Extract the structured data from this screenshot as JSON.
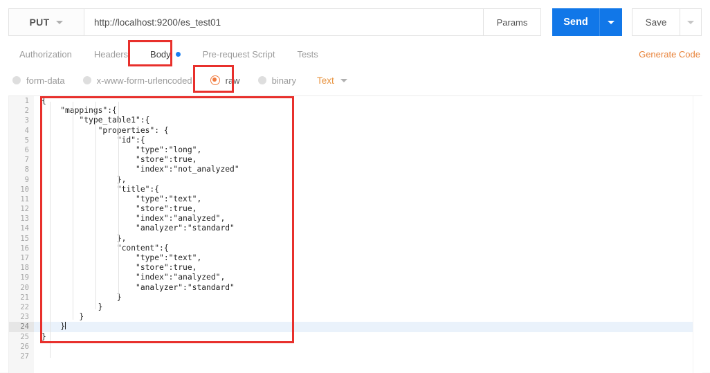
{
  "request": {
    "method": "PUT",
    "url": "http://localhost:9200/es_test01",
    "params_label": "Params",
    "send_label": "Send",
    "save_label": "Save"
  },
  "tabs": [
    {
      "label": "Authorization",
      "active": false,
      "dot": false
    },
    {
      "label": "Headers",
      "active": false,
      "dot": false
    },
    {
      "label": "Body",
      "active": true,
      "dot": true
    },
    {
      "label": "Pre-request Script",
      "active": false,
      "dot": false
    },
    {
      "label": "Tests",
      "active": false,
      "dot": false
    }
  ],
  "generate_code_label": "Generate Code",
  "body_types": [
    {
      "label": "form-data",
      "selected": false
    },
    {
      "label": "x-www-form-urlencoded",
      "selected": false
    },
    {
      "label": "raw",
      "selected": true
    },
    {
      "label": "binary",
      "selected": false
    }
  ],
  "content_type": "Text",
  "editor": {
    "active_line": 24,
    "total_lines": 27,
    "lines": [
      "{",
      "    \"mappings\":{",
      "        \"type_table1\":{",
      "            \"properties\": {",
      "                \"id\":{",
      "                    \"type\":\"long\",",
      "                    \"store\":true,",
      "                    \"index\":\"not_analyzed\"",
      "                },",
      "                \"title\":{",
      "                    \"type\":\"text\",",
      "                    \"store\":true,",
      "                    \"index\":\"analyzed\",",
      "                    \"analyzer\":\"standard\"",
      "                },",
      "                \"content\":{",
      "                    \"type\":\"text\",",
      "                    \"store\":true,",
      "                    \"index\":\"analyzed\",",
      "                    \"analyzer\":\"standard\"",
      "                }",
      "            }",
      "        }",
      "    }",
      "}",
      "",
      ""
    ]
  },
  "annotations": {
    "color": "#e8302c",
    "boxes": [
      "body-tab",
      "raw-radio",
      "request-body-json"
    ]
  },
  "colors": {
    "send_blue": "#1177e8",
    "accent_orange": "#e8833a",
    "active_line": "#eaf2fb"
  }
}
